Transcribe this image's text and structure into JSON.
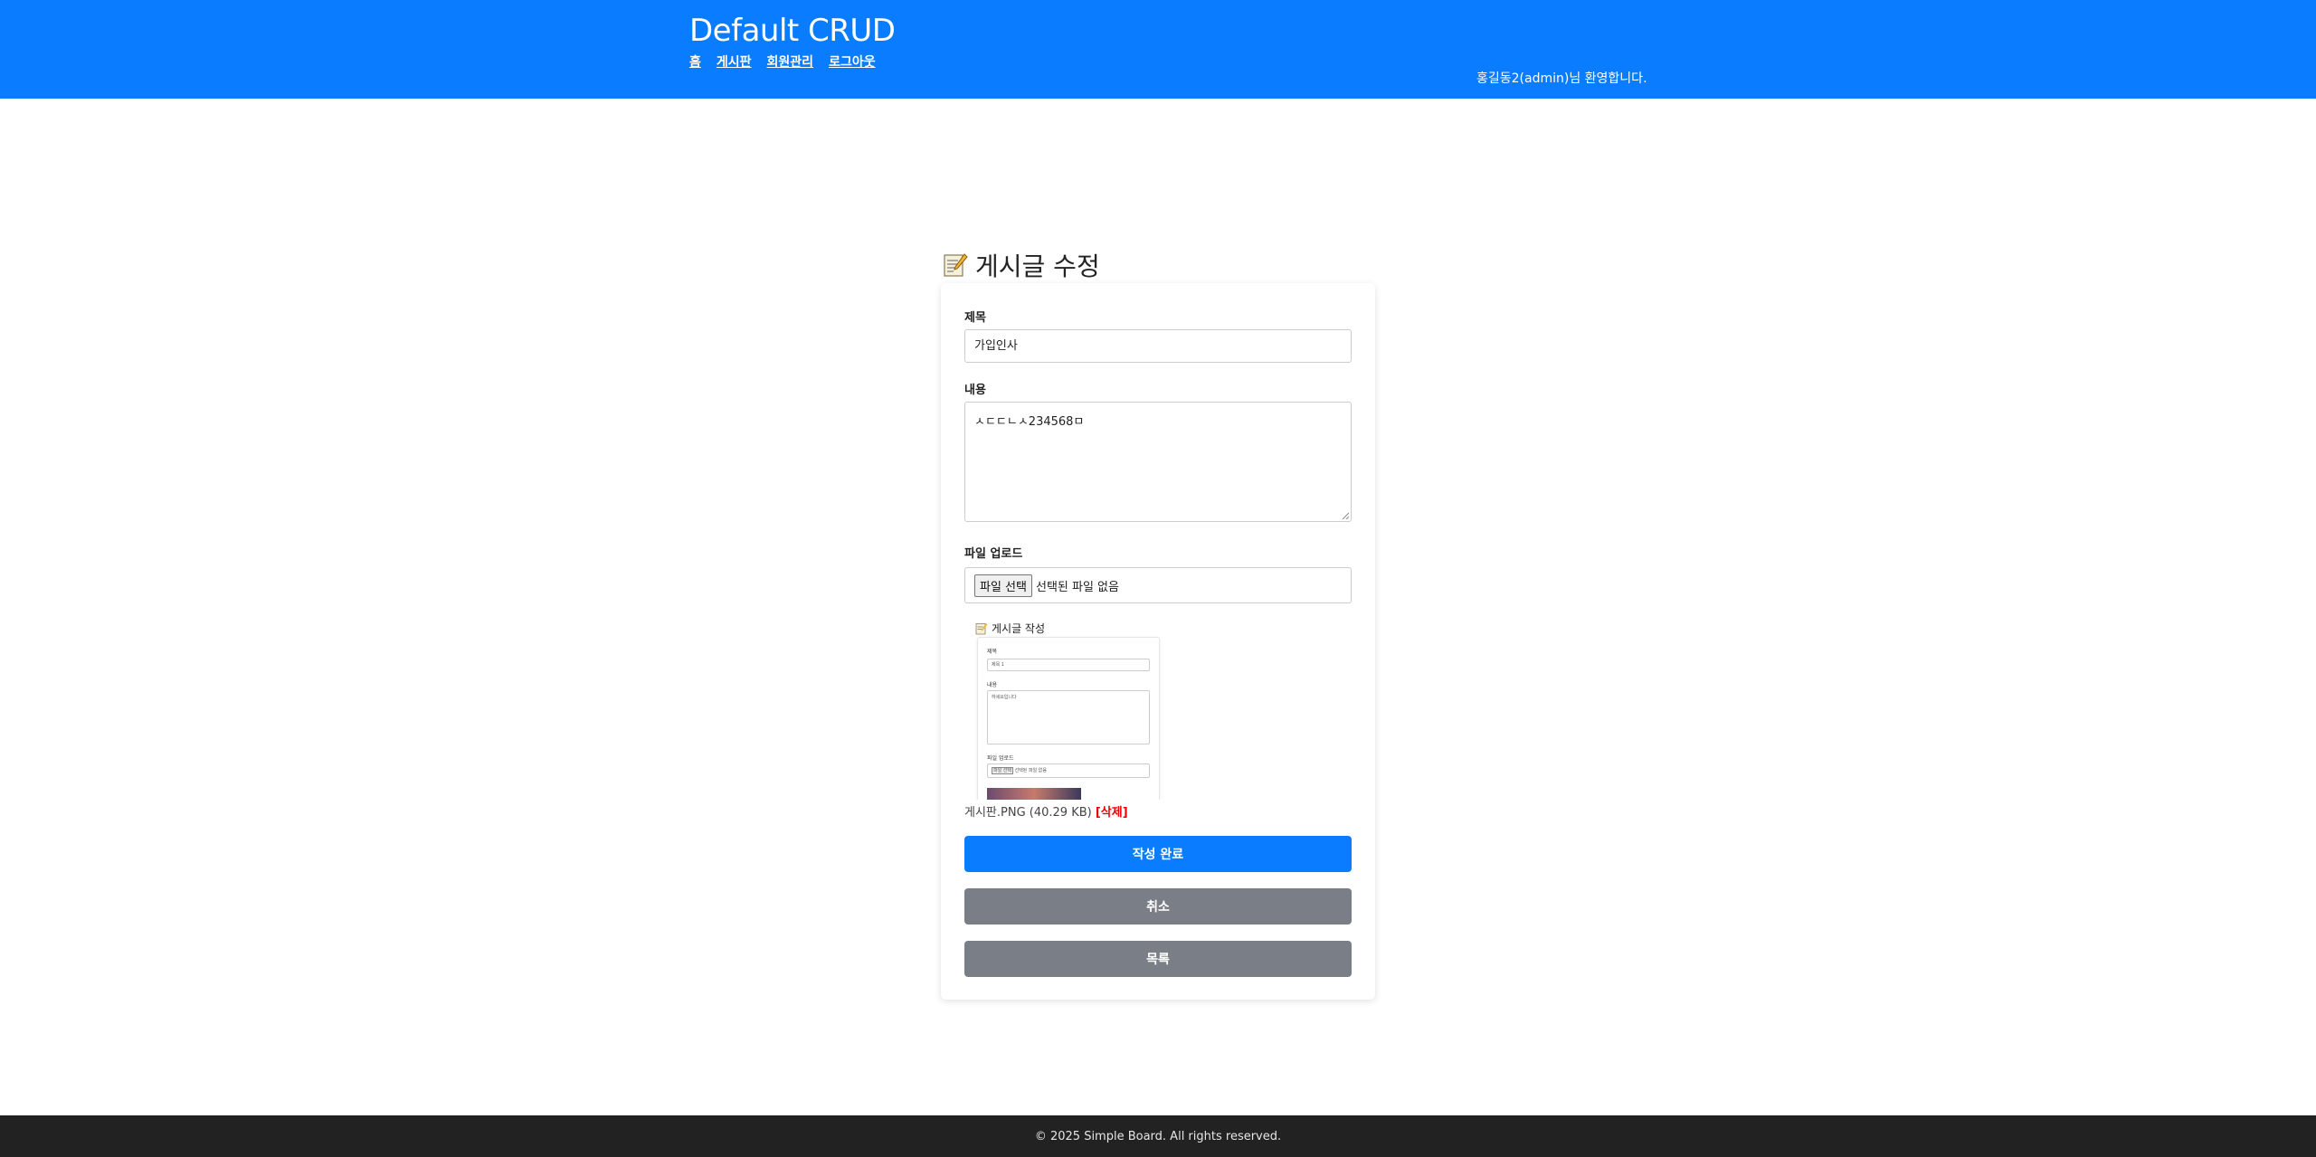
{
  "header": {
    "brand": "Default CRUD",
    "nav": [
      "홈",
      "게시판",
      "회원관리",
      "로그아웃"
    ],
    "welcome": "홍길동2(admin)님 환영합니다."
  },
  "page": {
    "title": "게시글 수정",
    "title_icon": "memo-icon"
  },
  "form": {
    "title_label": "제목",
    "title_value": "가입인사",
    "content_label": "내용",
    "content_value": "ㅅㄷㄷㄴㅅ234568ㅁ",
    "file_label": "파일 업로드",
    "file_button": "파일 선택",
    "file_status": "선택된 파일 없음"
  },
  "attachment": {
    "preview": {
      "title": "게시글 작성",
      "title_label": "제목",
      "title_value": "제목 1",
      "content_label": "내용",
      "content_value": "하세요입니다",
      "file_label": "파일 업로드",
      "file_button": "파일 선택",
      "file_status": "선택된 파일 없음"
    },
    "file_name": "게시판.PNG (40.29 KB)",
    "delete_label": "[삭제]"
  },
  "buttons": {
    "submit": "작성 완료",
    "cancel": "취소",
    "list": "목록"
  },
  "footer": {
    "text": "© 2025 Simple Board. All rights reserved."
  },
  "colors": {
    "primary": "#0a7cff",
    "secondary": "#7a7f87",
    "danger": "#ee0000",
    "footer_bg": "#222222"
  }
}
